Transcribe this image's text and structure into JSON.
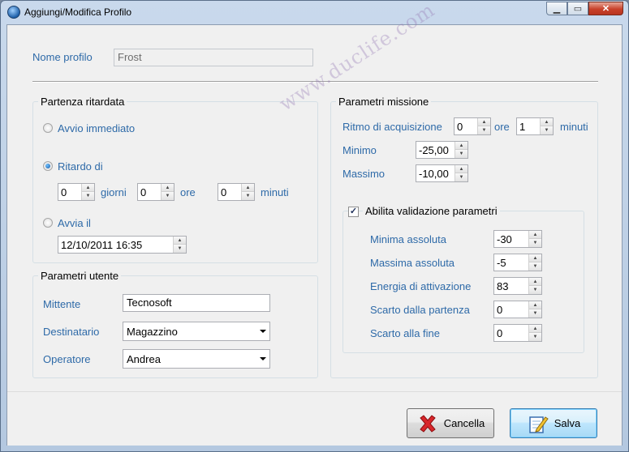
{
  "window": {
    "title": "Aggiungi/Modifica Profilo"
  },
  "profile": {
    "name_label": "Nome profilo",
    "name_value": "Frost"
  },
  "delayed_start": {
    "group_title": "Partenza ritardata",
    "immediate_label": "Avvio immediato",
    "delay_label": "Ritardo di",
    "selected": "delay",
    "days_value": "0",
    "days_label": "giorni",
    "hours_value": "0",
    "hours_label": "ore",
    "minutes_value": "0",
    "minutes_label": "minuti",
    "start_at_label": "Avvia il",
    "start_at_value": "12/10/2011 16:35"
  },
  "user_params": {
    "group_title": "Parametri utente",
    "sender_label": "Mittente",
    "sender_value": "Tecnosoft",
    "recipient_label": "Destinatario",
    "recipient_value": "Magazzino",
    "operator_label": "Operatore",
    "operator_value": "Andrea"
  },
  "mission_params": {
    "group_title": "Parametri missione",
    "rate_label": "Ritmo di acquisizione",
    "rate_hours_value": "0",
    "rate_hours_label": "ore",
    "rate_minutes_value": "1",
    "rate_minutes_label": "minuti",
    "min_label": "Minimo",
    "min_value": "-25,00",
    "max_label": "Massimo",
    "max_value": "-10,00"
  },
  "validation": {
    "enable_label": "Abilita validazione parametri",
    "enabled": true,
    "abs_min_label": "Minima assoluta",
    "abs_min_value": "-30",
    "abs_max_label": "Massima assoluta",
    "abs_max_value": "-5",
    "activation_energy_label": "Energia di attivazione",
    "activation_energy_value": "83",
    "start_offset_label": "Scarto dalla partenza",
    "start_offset_value": "0",
    "end_offset_label": "Scarto alla fine",
    "end_offset_value": "0"
  },
  "buttons": {
    "cancel_label": "Cancella",
    "save_label": "Salva"
  },
  "watermark": "www.duclife.com"
}
